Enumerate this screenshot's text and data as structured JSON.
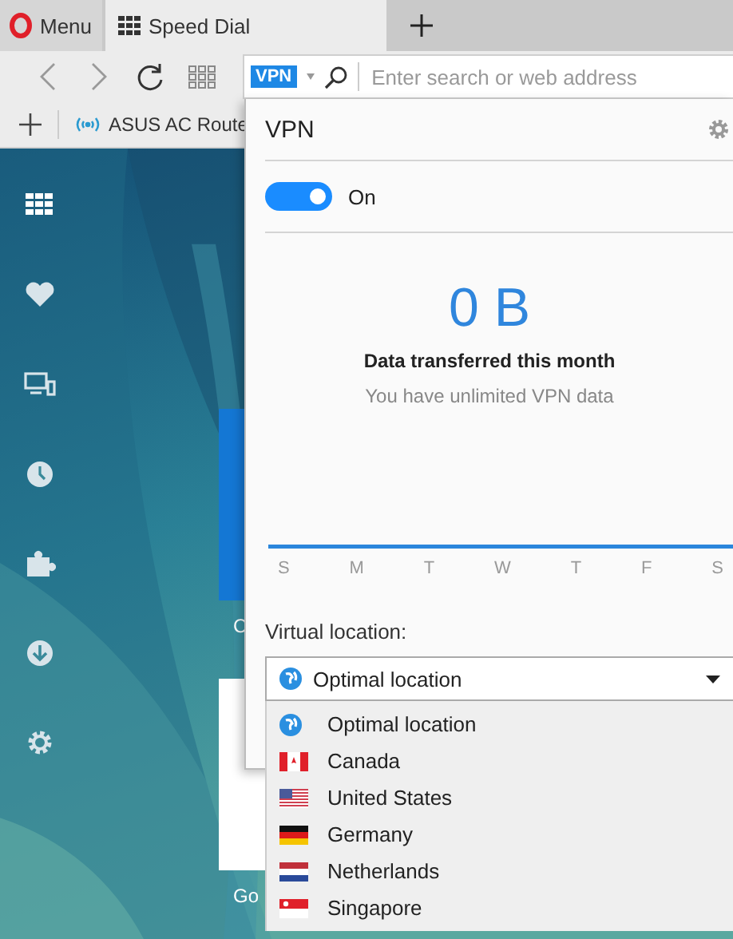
{
  "tabs": [
    {
      "label": "Menu",
      "kind": "menu",
      "selected": false
    },
    {
      "label": "Speed Dial",
      "kind": "page",
      "selected": true
    }
  ],
  "address_bar": {
    "badge": "VPN",
    "placeholder": "Enter search or web address"
  },
  "bookmarks": [
    {
      "label": "ASUS AC Route"
    }
  ],
  "speed_dial": [
    {
      "kind": "blue",
      "caption": "C"
    },
    {
      "kind": "white",
      "caption": "Go"
    }
  ],
  "vpn_popup": {
    "title": "VPN",
    "toggle": {
      "label": "On",
      "on": true
    },
    "data_amount": "0 B",
    "data_caption": "Data transferred this month",
    "data_note": "You have unlimited VPN data",
    "week_days": [
      "S",
      "M",
      "T",
      "W",
      "T",
      "F",
      "S"
    ],
    "location_label": "Virtual location:",
    "location_select": {
      "value": "Optimal location",
      "kind": "optimal",
      "expanded": true
    },
    "locations": [
      {
        "name": "Optimal location",
        "kind": "optimal"
      },
      {
        "name": "Canada",
        "kind": "ca"
      },
      {
        "name": "United States",
        "kind": "us"
      },
      {
        "name": "Germany",
        "kind": "de"
      },
      {
        "name": "Netherlands",
        "kind": "nl"
      },
      {
        "name": "Singapore",
        "kind": "sg"
      }
    ]
  }
}
